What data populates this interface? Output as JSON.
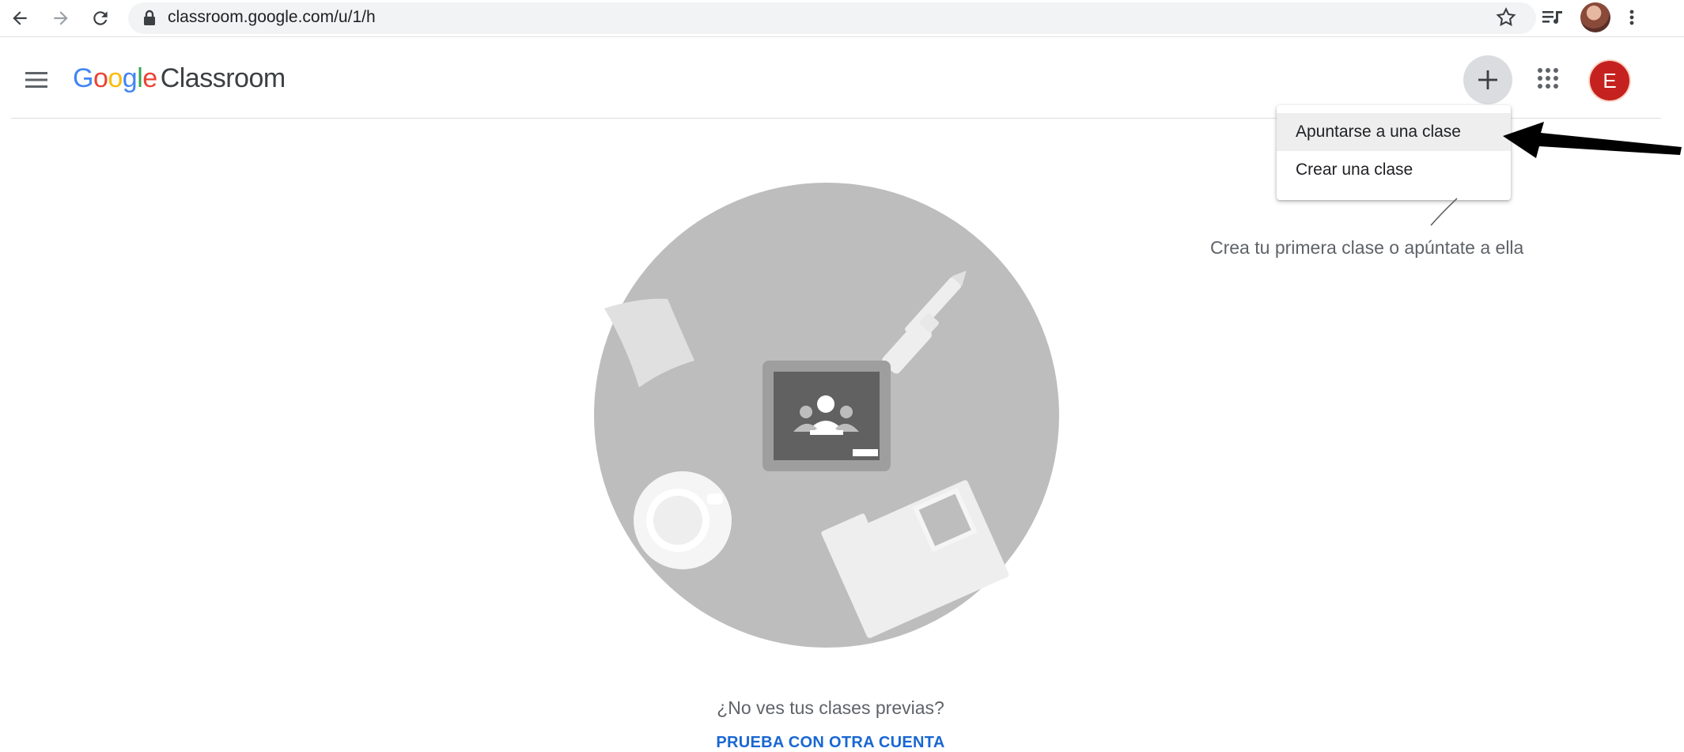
{
  "browser": {
    "url": "classroom.google.com/u/1/h"
  },
  "header": {
    "logo_google": [
      "G",
      "o",
      "o",
      "g",
      "l",
      "e"
    ],
    "logo_product": "Classroom",
    "account_initial": "E"
  },
  "menu": {
    "items": [
      {
        "label": "Apuntarse a una clase",
        "highlighted": true
      },
      {
        "label": "Crear una clase",
        "highlighted": false
      }
    ]
  },
  "main": {
    "hint": "Crea tu primera clase o apúntate a ella",
    "no_classes_text": "¿No ves tus clases previas?",
    "try_other_account": "PRUEBA CON OTRA CUENTA"
  },
  "colors": {
    "avatar": "#c5221f",
    "link": "#1967d2"
  }
}
